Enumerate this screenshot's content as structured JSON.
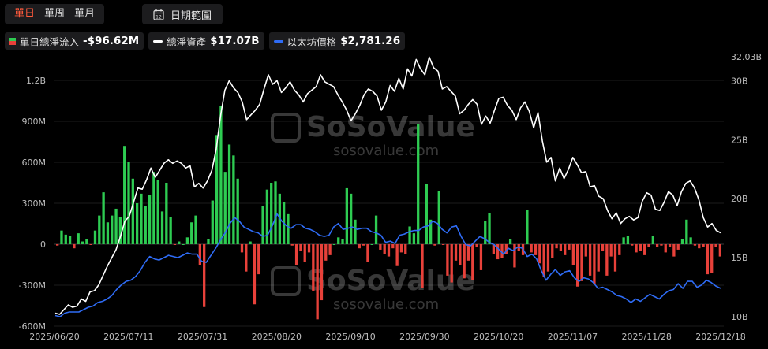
{
  "toolbar": {
    "periods": [
      "單日",
      "單周",
      "單月"
    ],
    "active_period": 0,
    "date_range_label": "日期範圍",
    "calendar_icon_num": "12"
  },
  "legend": {
    "inflow": {
      "label": "單日總淨流入",
      "value": "-$96.62M",
      "pos_color": "#2ecc52",
      "neg_color": "#e8413a"
    },
    "nav": {
      "label": "總淨資產",
      "value": "$17.07B",
      "color": "#ffffff"
    },
    "eth": {
      "label": "以太坊價格",
      "value": "$2,781.26",
      "color": "#2f6cf6"
    }
  },
  "watermark": {
    "brand": "SoSoValue",
    "url": "sosovalue.com"
  },
  "chart_data": {
    "type": "bar+line",
    "x_labels": [
      "2025/06/20",
      "2025/07/11",
      "2025/07/31",
      "2025/08/20",
      "2025/09/10",
      "2025/09/30",
      "2025/10/20",
      "2025/11/07",
      "2025/11/28",
      "2025/12/18"
    ],
    "left_axis": {
      "ticks": [
        "1.2B",
        "900M",
        "600M",
        "300M",
        "0",
        "-300M",
        "-600M"
      ],
      "values": [
        1200,
        900,
        600,
        300,
        0,
        -300,
        -600
      ],
      "unit": "M"
    },
    "right_axis": {
      "ticks": [
        "32.03B",
        "30B",
        "25B",
        "20B",
        "15B",
        "10B"
      ],
      "values": [
        32.03,
        30,
        25,
        20,
        15,
        10
      ],
      "unit": "B"
    },
    "grid": "horizontal",
    "series": [
      {
        "name": "單日總淨流入",
        "kind": "bar",
        "values": [
          -10,
          100,
          70,
          60,
          -30,
          80,
          20,
          40,
          -5,
          100,
          210,
          380,
          160,
          210,
          260,
          200,
          720,
          600,
          480,
          300,
          370,
          280,
          360,
          530,
          470,
          240,
          450,
          200,
          -5,
          20,
          0,
          50,
          160,
          210,
          -150,
          -460,
          40,
          320,
          800,
          1010,
          530,
          730,
          650,
          480,
          -60,
          -200,
          20,
          -440,
          -220,
          280,
          400,
          450,
          460,
          370,
          310,
          220,
          -10,
          -150,
          -50,
          -130,
          -60,
          -340,
          -550,
          -410,
          -120,
          -80,
          0,
          50,
          40,
          410,
          370,
          180,
          -30,
          -10,
          -130,
          0,
          210,
          -40,
          -70,
          -90,
          -30,
          -160,
          -60,
          -70,
          130,
          80,
          880,
          -320,
          440,
          180,
          -10,
          390,
          -5,
          -230,
          -280,
          -120,
          -150,
          -250,
          -120,
          -260,
          -20,
          -190,
          170,
          230,
          -70,
          -110,
          -100,
          -70,
          40,
          -170,
          -50,
          -80,
          250,
          -60,
          -80,
          -140,
          -240,
          -200,
          -100,
          -30,
          -50,
          -80,
          -40,
          -150,
          -310,
          -270,
          -90,
          -230,
          -290,
          -200,
          -50,
          -230,
          -90,
          -200,
          -80,
          50,
          60,
          -10,
          -60,
          -50,
          -80,
          -20,
          60,
          -20,
          -10,
          -60,
          -20,
          -90,
          -40,
          40,
          180,
          50,
          -10,
          -30,
          -20,
          -220,
          -210,
          -20,
          -90
        ]
      },
      {
        "name": "總淨資產",
        "kind": "line",
        "axis": "right",
        "values": [
          10.3,
          10.2,
          10.6,
          11,
          10.8,
          10.9,
          11.5,
          11.3,
          12.1,
          12.2,
          12.7,
          13.5,
          14.3,
          15,
          15.7,
          16.8,
          18.1,
          18.5,
          19.7,
          20.9,
          20.8,
          21.6,
          22.6,
          21.8,
          22.4,
          23,
          23.3,
          23,
          23.2,
          23,
          22.6,
          22.8,
          21,
          21.3,
          20.9,
          21.5,
          22.4,
          24.2,
          27,
          29.2,
          30,
          29.4,
          29,
          28.2,
          26.7,
          27.1,
          27.5,
          28,
          29.3,
          30.5,
          29.7,
          30,
          29,
          29.4,
          29.9,
          29.2,
          28.8,
          28.2,
          28.9,
          29.2,
          29.5,
          30.5,
          29.9,
          29.7,
          29.5,
          28.8,
          28.2,
          27.5,
          26.6,
          27.2,
          27.9,
          28.8,
          29.3,
          29.1,
          28.7,
          27.5,
          28.2,
          29.6,
          29.1,
          30.2,
          29.3,
          31,
          30.4,
          31.8,
          31,
          30.5,
          32,
          31.1,
          30.8,
          29.3,
          29.5,
          29.1,
          28.7,
          27.2,
          27.5,
          28,
          28.4,
          28,
          26.3,
          27,
          26.4,
          27.5,
          28.5,
          28.6,
          27.9,
          27.5,
          26.7,
          27.7,
          28.2,
          27.4,
          26,
          27.3,
          24.9,
          23.1,
          23.5,
          21.5,
          22.6,
          21.7,
          22.5,
          23.5,
          22.9,
          22.2,
          22.3,
          21,
          21.1,
          20.2,
          20,
          19,
          18.3,
          18.8,
          17.9,
          18.3,
          18.5,
          18.2,
          18.4,
          19.8,
          20.5,
          20.3,
          19.1,
          19,
          19.7,
          20.6,
          20.3,
          19.4,
          20.6,
          21.3,
          21.5,
          20.9,
          19.9,
          18.4,
          17.6,
          17.9,
          17.3,
          17.1
        ]
      },
      {
        "name": "以太坊價格",
        "kind": "line",
        "axis": "right",
        "values": [
          10.1,
          10,
          10.3,
          10.4,
          10.4,
          10.4,
          10.6,
          10.8,
          10.9,
          11.2,
          11.3,
          11.5,
          11.8,
          12.3,
          12.7,
          13,
          13.1,
          13.4,
          13.9,
          14.6,
          15.1,
          14.9,
          14.8,
          15,
          15.2,
          15.1,
          15,
          15.2,
          15.4,
          15.3,
          15.3,
          14.7,
          14.6,
          15.2,
          15.8,
          16.5,
          17.1,
          17.9,
          18.4,
          18.1,
          17.6,
          17.4,
          17.2,
          17.1,
          16.8,
          16.9,
          17.7,
          18.7,
          18.1,
          17.7,
          17.5,
          17.8,
          17.8,
          17.5,
          17.4,
          17.2,
          16.9,
          16.8,
          16.9,
          17.6,
          17.9,
          17.4,
          17.5,
          17.6,
          17.4,
          17.5,
          17.5,
          17.2,
          17.1,
          16.9,
          16.3,
          16.4,
          16.2,
          16.9,
          17,
          17.2,
          17.3,
          17.3,
          17.6,
          17.7,
          18.1,
          17.9,
          17.4,
          17.1,
          17.6,
          17.7,
          16.8,
          16.1,
          16,
          16.4,
          16.8,
          16.6,
          16.3,
          16.1,
          15.7,
          15.3,
          15.8,
          15.6,
          15.9,
          15.8,
          15.1,
          15.3,
          14.9,
          13.9,
          13.1,
          13.6,
          14,
          13.5,
          13.8,
          13.9,
          13.3,
          13,
          13.3,
          13.2,
          12.9,
          12.4,
          12.5,
          12.3,
          12.1,
          11.8,
          11.7,
          11.5,
          11.2,
          11.5,
          11.3,
          11.6,
          11.9,
          11.7,
          11.5,
          11.9,
          12.2,
          12.3,
          12.8,
          12.4,
          13,
          13,
          12.5,
          12.7,
          13.1,
          12.9,
          12.6,
          12.4
        ]
      }
    ]
  }
}
